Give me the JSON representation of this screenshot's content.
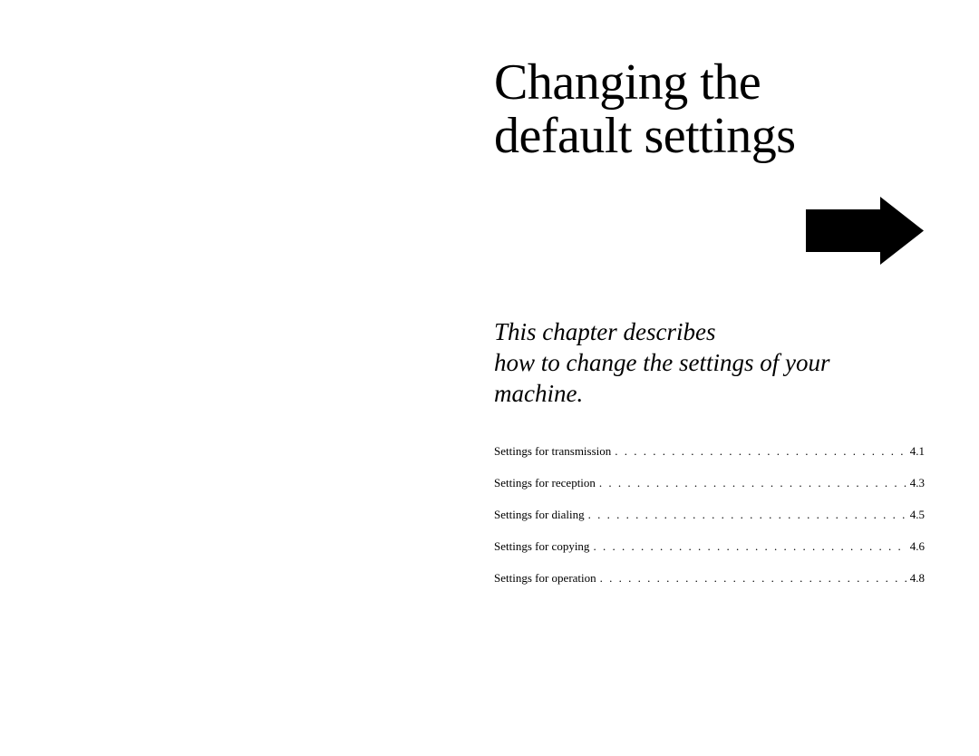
{
  "title": {
    "line1": "Changing the",
    "line2": "default settings"
  },
  "description": {
    "line1": "This chapter describes",
    "line2": "how to change the settings of your",
    "line3": "machine."
  },
  "toc": [
    {
      "label": "Settings for transmission",
      "page": "4.1"
    },
    {
      "label": "Settings for reception",
      "page": "4.3"
    },
    {
      "label": "Settings for dialing",
      "page": "4.5"
    },
    {
      "label": "Settings for copying",
      "page": "4.6"
    },
    {
      "label": "Settings for operation",
      "page": "4.8"
    }
  ]
}
